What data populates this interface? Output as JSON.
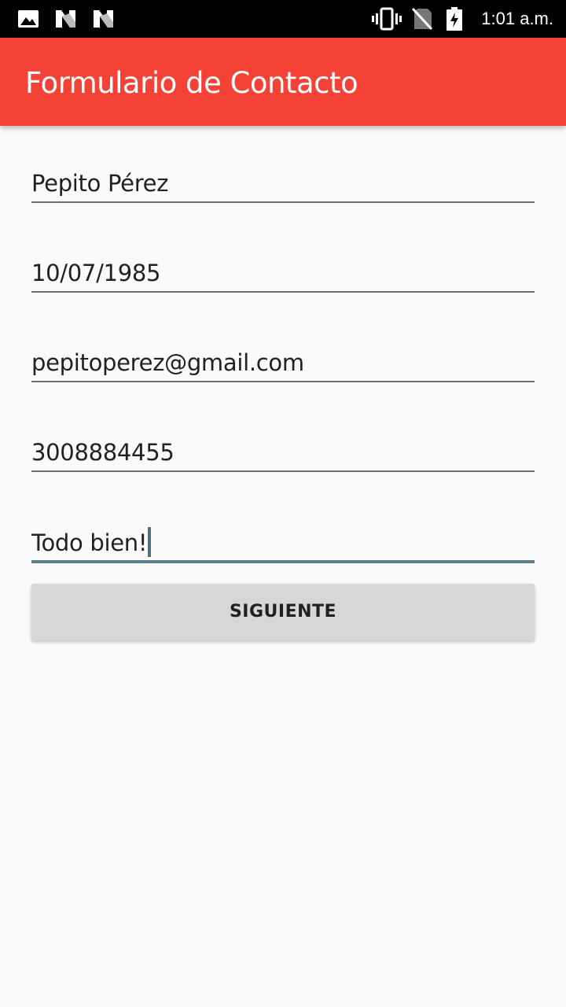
{
  "status_bar": {
    "time": "1:01 a.m.",
    "left_icons": [
      "image-icon",
      "n-notification-icon",
      "n-notification-icon"
    ],
    "right_icons": [
      "vibrate-icon",
      "no-sim-icon",
      "battery-charging-icon"
    ]
  },
  "app_bar": {
    "title": "Formulario de Contacto",
    "color": "#f44336"
  },
  "form": {
    "fields": [
      {
        "value": "Pepito Pérez"
      },
      {
        "value": "10/07/1985"
      },
      {
        "value": "pepitoperez@gmail.com"
      },
      {
        "value": "3008884455"
      },
      {
        "value": "Todo bien!",
        "focused": true
      }
    ],
    "submit_label": "SIGUIENTE",
    "focus_color": "#607d8b"
  }
}
